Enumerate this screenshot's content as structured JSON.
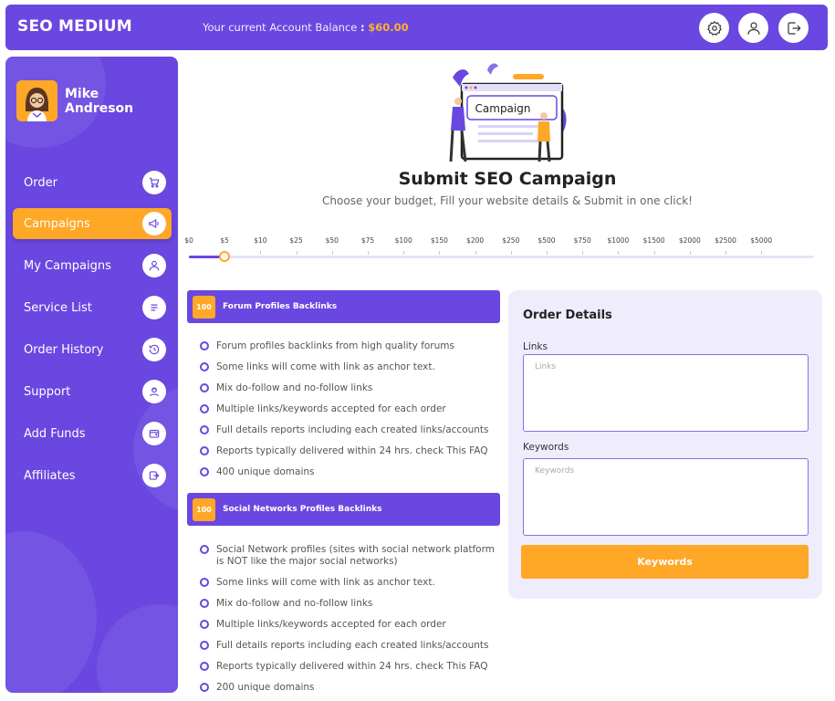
{
  "header": {
    "brand": "SEO MEDIUM",
    "balance_label": "Your current Account Balance",
    "balance_colon": ":",
    "balance_value": "$60.00",
    "icons": [
      "settings-icon",
      "user-icon",
      "logout-icon"
    ]
  },
  "user": {
    "name": "Mike Andreson"
  },
  "sidebar": {
    "items": [
      {
        "label": "Order",
        "icon": "cart-icon"
      },
      {
        "label": "Campaigns",
        "icon": "megaphone-icon",
        "active": true
      },
      {
        "label": "My Campaigns",
        "icon": "user-icon"
      },
      {
        "label": "Service List",
        "icon": "list-icon"
      },
      {
        "label": "Order History",
        "icon": "history-icon"
      },
      {
        "label": "Support",
        "icon": "support-icon"
      },
      {
        "label": "Add Funds",
        "icon": "wallet-icon"
      },
      {
        "label": "Affiliates",
        "icon": "share-icon"
      }
    ]
  },
  "hero": {
    "image_label": "Campaign"
  },
  "main": {
    "title": "Submit SEO Campaign",
    "subtitle": "Choose your budget, Fill your website details & Submit in one click!"
  },
  "budget_slider": {
    "ticks": [
      "$0",
      "$5",
      "$10",
      "$25",
      "$50",
      "$75",
      "$100",
      "$150",
      "$200",
      "$250",
      "$500",
      "$750",
      "$1000",
      "$1500",
      "$2000",
      "$2500",
      "$5000"
    ],
    "selected": "$5"
  },
  "sections": [
    {
      "badge": "100",
      "title": "Forum Profiles Backlinks",
      "features": [
        "Forum profiles backlinks from high quality forums",
        "Some links will come with link as anchor text.",
        "Mix do-follow and no-follow links",
        "Multiple links/keywords accepted for each order",
        "Full details reports including each created links/accounts",
        "Reports typically delivered within 24 hrs. check This FAQ",
        "400 unique domains"
      ]
    },
    {
      "badge": "100",
      "title": "Social Networks Profiles Backlinks",
      "features": [
        "Social Network profiles (sites with social network platform is NOT like the major social networks)",
        "Some links will come with link as anchor text.",
        "Mix do-follow and no-follow links",
        "Multiple links/keywords accepted for each order",
        "Full details reports including each created links/accounts",
        "Reports typically delivered within 24 hrs. check This FAQ",
        "200 unique domains"
      ]
    }
  ],
  "order": {
    "title": "Order Details",
    "links_label": "Links",
    "links_placeholder": "Links",
    "keywords_label": "Keywords",
    "keywords_placeholder": "Keywords",
    "submit_label": "Keywords"
  },
  "colors": {
    "primary": "#6a47e0",
    "accent": "#ffa726",
    "panel": "#efecfb"
  }
}
